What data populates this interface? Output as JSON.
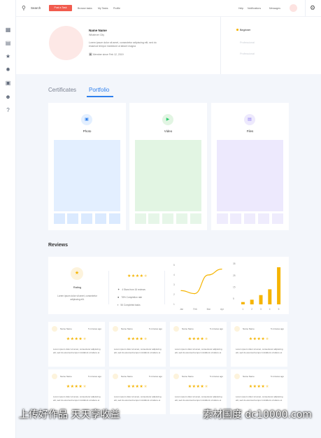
{
  "topbar": {
    "search_label": "Search",
    "post_button": "Post a Task",
    "nav": [
      "Browse tasks",
      "My Tasks",
      "Profile"
    ],
    "right": [
      "Help",
      "Notifications",
      "Messages"
    ]
  },
  "profile": {
    "name": "Name Name",
    "subtitle": "Whatever City",
    "bio": "Lorem ipsum dolor sit amet, consectetur adipiscing elit, sed do eiusmod tempor incididunt ut labore magna",
    "member_since": "Member since   Feb 12, 2019",
    "levels": [
      {
        "label": "Beginner",
        "color": "#f5b400"
      },
      {
        "label": "Professional",
        "color": "#d6d9df"
      },
      {
        "label": "Professional",
        "color": "#d6d9df"
      }
    ]
  },
  "tabs": {
    "certificates": "Certificates",
    "portfolio": "Portfolio"
  },
  "portfolio": [
    {
      "title": "Photo",
      "icon": "photo-icon",
      "accent": "#2f80ed",
      "bg": "#e3efff",
      "thumb": "#dbeaff"
    },
    {
      "title": "Video",
      "icon": "video-icon",
      "accent": "#2ecc71",
      "bg": "#e2f5e3",
      "thumb": "#e6f6e8"
    },
    {
      "title": "Files",
      "icon": "files-icon",
      "accent": "#8e7cf0",
      "bg": "#ede9fd",
      "thumb": "#efecfd"
    }
  ],
  "reviews": {
    "title": "Reviews",
    "rating_label": "Rating",
    "rating_desc": "Lorem ipsum dolor sit amet, consectetur adipiscing elit.",
    "stats": [
      "4 Stars from 16 reviews",
      "78% Completion rate",
      "56 Completed tasks"
    ],
    "cards_name": "Name Name",
    "cards_time": "5 minutes ago",
    "cards_text": "Lorem ipsum dolor sit amet, consectetur adipiscing elit, sed do eiusmod tempor incididunt ut labore et"
  },
  "chart_data": [
    {
      "type": "line",
      "x": [
        "Jan",
        "Feb",
        "Mar",
        "Apr"
      ],
      "values": [
        2.4,
        2.1,
        4.0,
        4.6
      ],
      "ylim": [
        1,
        5
      ],
      "yticks": [
        "5",
        "4",
        "3",
        "2",
        "1"
      ],
      "color": "#f5b400"
    },
    {
      "type": "bar",
      "categories": [
        "1",
        "2",
        "3",
        "4",
        "5"
      ],
      "values": [
        2,
        4,
        8,
        13,
        32
      ],
      "ylim": [
        0,
        35
      ],
      "yticks": [
        "35",
        "25",
        "15",
        "5"
      ],
      "color": "#f5b400"
    }
  ]
}
